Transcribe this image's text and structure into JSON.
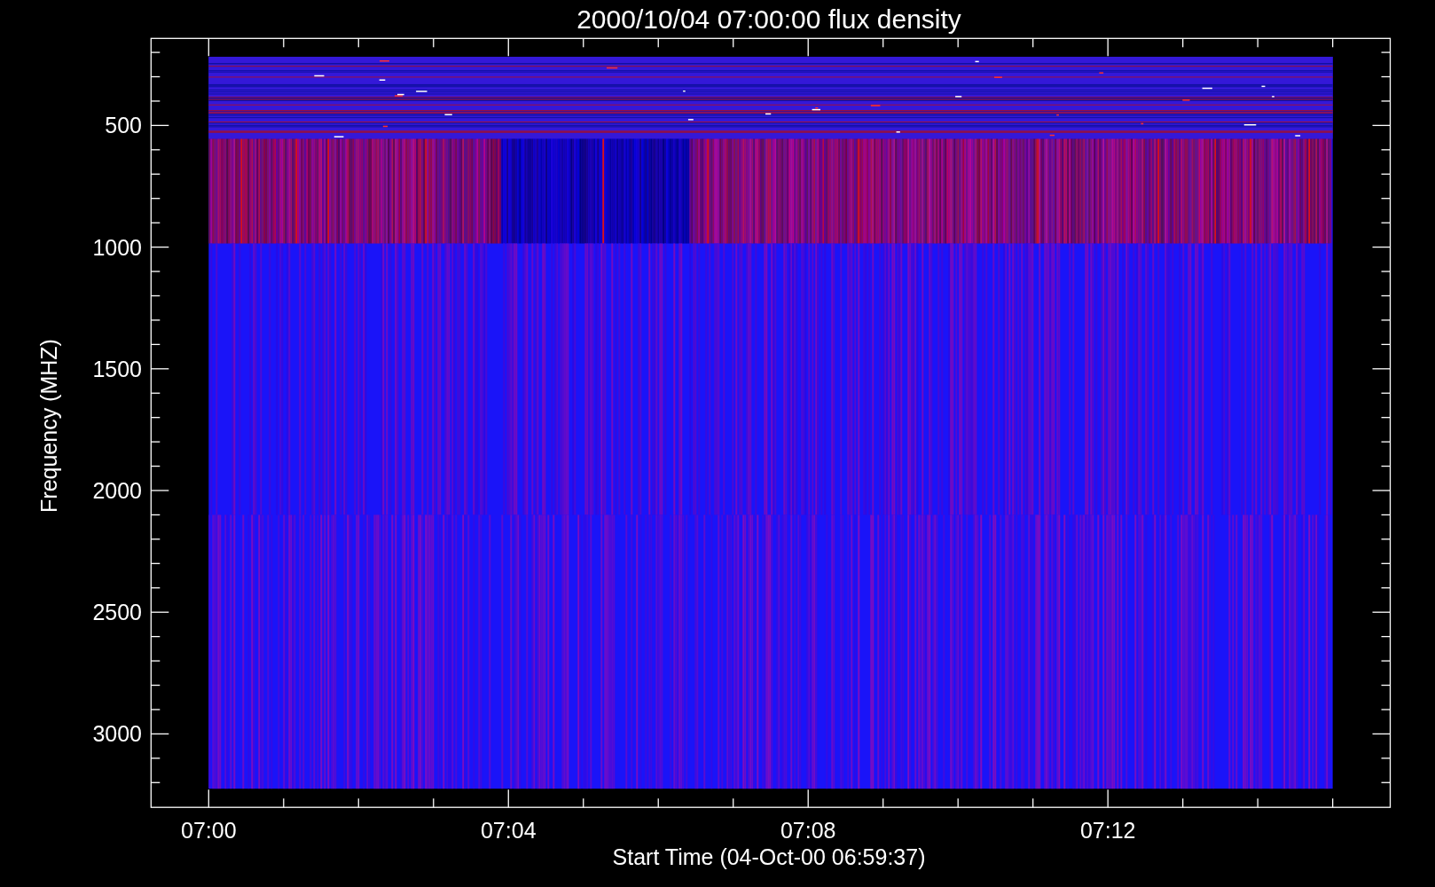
{
  "plot": {
    "title": "2000/10/04 07:00:00 flux density",
    "x_axis": {
      "label": "Start Time (04-Oct-00 06:59:37)",
      "tick_labels": [
        "07:00",
        "07:04",
        "07:08",
        "07:12"
      ]
    },
    "y_axis": {
      "label": "Frequency (MHZ)",
      "tick_labels": [
        "500",
        "1000",
        "1500",
        "2000",
        "2500",
        "3000"
      ]
    }
  }
}
